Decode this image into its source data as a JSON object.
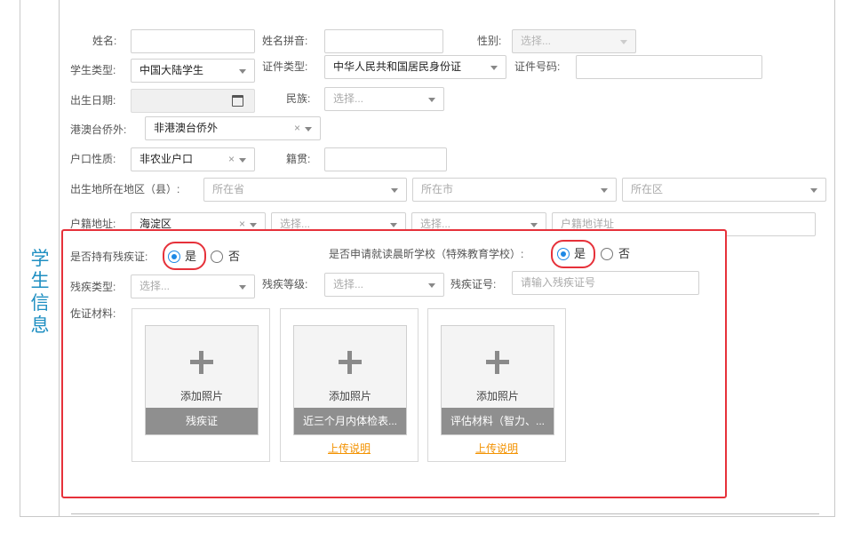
{
  "side_title": [
    "学",
    "生",
    "信",
    "息"
  ],
  "row1": {
    "name_label": "姓名:",
    "pinyin_label": "姓名拼音:",
    "gender_label": "性别:",
    "gender_value": "选择..."
  },
  "row2": {
    "student_type_label": "学生类型:",
    "student_type_value": "中国大陆学生",
    "id_type_label": "证件类型:",
    "id_type_value": "中华人民共和国居民身份证",
    "id_number_label": "证件号码:"
  },
  "row3": {
    "birth_label": "出生日期:",
    "ethnic_label": "民族:",
    "ethnic_value": "选择..."
  },
  "row4": {
    "hk_label": "港澳台侨外:",
    "hk_value": "非港澳台侨外",
    "hk_clear": "×"
  },
  "row5": {
    "hukou_type_label": "户口性质:",
    "hukou_type_value": "非农业户口",
    "hukou_clear": "×",
    "native_label": "籍贯:"
  },
  "row6": {
    "birthplace_label": "出生地所在地区（县）:",
    "province_ph": "所在省",
    "city_ph": "所在市",
    "district_ph": "所在区"
  },
  "row7": {
    "hukou_addr_label": "户籍地址:",
    "hukou_district_value": "海淀区",
    "hukou_clear": "×",
    "select1_ph": "选择...",
    "select2_ph": "选择...",
    "detail_ph": "户籍地详址"
  },
  "disability": {
    "has_cert_label": "是否持有残疾证:",
    "yes": "是",
    "no": "否",
    "special_school_label": "是否申请就读晨昕学校（特殊教育学校）:",
    "type_label": "残疾类型:",
    "type_ph": "选择...",
    "level_label": "残疾等级:",
    "level_ph": "选择...",
    "cert_no_label": "残疾证号:",
    "cert_no_ph": "请输入残疾证号",
    "materials_label": "佐证材料:"
  },
  "uploads": [
    {
      "add": "添加照片",
      "caption": "残疾证",
      "link": ""
    },
    {
      "add": "添加照片",
      "caption": "近三个月内体检表...",
      "link": "上传说明"
    },
    {
      "add": "添加照片",
      "caption": "评估材料（智力、...",
      "link": "上传说明"
    }
  ],
  "colors": {
    "accent": "#1e88e5",
    "highlight": "#e6313a",
    "link": "#f39200",
    "side_title": "#1f8fc2"
  }
}
